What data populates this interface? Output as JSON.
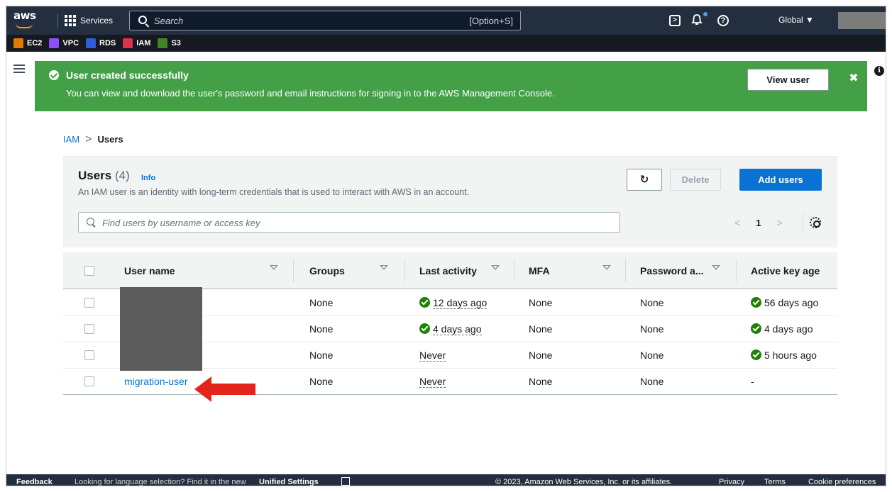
{
  "topnav": {
    "logo_text": "aws",
    "services_label": "Services",
    "search_placeholder": "Search",
    "search_shortcut": "[Option+S]",
    "region_label": "Global ▼"
  },
  "favorites": [
    {
      "label": "EC2",
      "color": "#e07b00"
    },
    {
      "label": "VPC",
      "color": "#8c4fff"
    },
    {
      "label": "RDS",
      "color": "#2e5fd6"
    },
    {
      "label": "IAM",
      "color": "#dd344c"
    },
    {
      "label": "S3",
      "color": "#3f8624"
    }
  ],
  "flash": {
    "title": "User created successfully",
    "description": "You can view and download the user's password and email instructions for signing in to the AWS Management Console.",
    "button_label": "View user",
    "close_symbol": "✖"
  },
  "breadcrumb": {
    "items": [
      "IAM",
      "Users"
    ],
    "separator": ">"
  },
  "users_panel": {
    "title": "Users",
    "count": "(4)",
    "info_label": "Info",
    "description": "An IAM user is an identity with long-term credentials that is used to interact with AWS in an account.",
    "refresh_symbol": "↻",
    "delete_label": "Delete",
    "add_label": "Add users",
    "filter_placeholder": "Find users by username or access key",
    "page_number": "1",
    "prev_symbol": "<",
    "next_symbol": ">"
  },
  "table": {
    "columns": [
      "User name",
      "Groups",
      "Last activity",
      "MFA",
      "Password a...",
      "Active key age"
    ],
    "rows": [
      {
        "user": "",
        "groups": "None",
        "last_activity": "12 days ago",
        "mfa": "None",
        "password": "None",
        "key_age": "56 days ago"
      },
      {
        "user": "",
        "groups": "None",
        "last_activity": "4 days ago",
        "mfa": "None",
        "password": "None",
        "key_age": "4 days ago"
      },
      {
        "user": "",
        "groups": "None",
        "last_activity": "Never",
        "mfa": "None",
        "password": "None",
        "key_age": "5 hours ago"
      },
      {
        "user": "migration-user",
        "groups": "None",
        "last_activity": "Never",
        "mfa": "None",
        "password": "None",
        "key_age": "-"
      }
    ]
  },
  "footer": {
    "feedback": "Feedback",
    "language_note": "Looking for language selection? Find it in the new",
    "unified_settings": "Unified Settings",
    "copyright": "© 2023, Amazon Web Services, Inc. or its affiliates.",
    "privacy": "Privacy",
    "terms": "Terms",
    "cookies": "Cookie preferences"
  },
  "colors": {
    "nav_bg": "#232f3e",
    "flash_green": "#43a047",
    "link_blue": "#0972d3",
    "primary_button": "#0972d3",
    "success_green": "#1d8102",
    "annotation_red": "#e3241b"
  }
}
